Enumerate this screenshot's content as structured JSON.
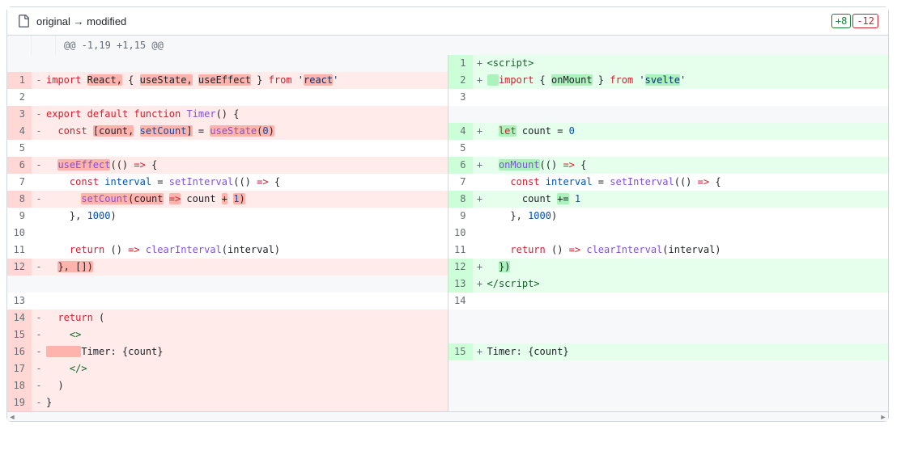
{
  "header": {
    "title": "original → modified",
    "badge_add": "+8",
    "badge_del": "-12"
  },
  "hunk": "@@ -1,19 +1,15 @@",
  "rows": [
    {
      "left": {
        "type": "empty"
      },
      "right": {
        "type": "add",
        "num": "1",
        "html": "<span class='tag'>&lt;script&gt;</span>"
      }
    },
    {
      "left": {
        "type": "del",
        "num": "1",
        "html": "<span class='kw'>import</span> <span class='wdel'>React,</span> { <span class='wdel'>useState,</span> <span class='wdel'>useEffect</span> } <span class='kw'>from</span> <span class='str'>'<span class='wdel'>react</span>'</span>"
      },
      "right": {
        "type": "add",
        "num": "2",
        "html": "<span class='wadd'>  </span><span class='kw'>import</span> { <span class='wadd'>onMount</span> } <span class='kw'>from</span> <span class='str'>'<span class='wadd'>svelte</span>'</span>"
      }
    },
    {
      "left": {
        "type": "ctx",
        "num": "2",
        "html": ""
      },
      "right": {
        "type": "ctx",
        "num": "3",
        "html": ""
      }
    },
    {
      "left": {
        "type": "del",
        "num": "3",
        "html": "<span class='kw'>export</span> <span class='kw'>default</span> <span class='kw'>function</span> <span class='fn'>Timer</span>() {"
      },
      "right": {
        "type": "empty"
      }
    },
    {
      "left": {
        "type": "del",
        "num": "4",
        "html": "  <span class='kw'>const</span> <span class='wdel'>[count,</span> <span class='wdel'><span class='def'>setCount</span>]</span> = <span class='wdel'><span class='fn'>useState</span>(<span class='num'>0</span>)</span>"
      },
      "right": {
        "type": "add",
        "num": "4",
        "html": "  <span class='wadd'><span class='kw'>let</span></span> count = <span class='num'>0</span>"
      }
    },
    {
      "left": {
        "type": "ctx",
        "num": "5",
        "html": ""
      },
      "right": {
        "type": "ctx",
        "num": "5",
        "html": ""
      }
    },
    {
      "left": {
        "type": "del",
        "num": "6",
        "html": "  <span class='wdel'><span class='fn'>useEffect</span></span>(() <span class='kw'>=&gt;</span> {"
      },
      "right": {
        "type": "add",
        "num": "6",
        "html": "  <span class='wadd'><span class='fn'>onMount</span></span>(() <span class='kw'>=&gt;</span> {"
      }
    },
    {
      "left": {
        "type": "ctx",
        "num": "7",
        "html": "    <span class='kw'>const</span> <span class='def'>interval</span> = <span class='fn'>setInterval</span>(() <span class='kw'>=&gt;</span> {"
      },
      "right": {
        "type": "ctx",
        "num": "7",
        "html": "    <span class='kw'>const</span> <span class='def'>interval</span> = <span class='fn'>setInterval</span>(() <span class='kw'>=&gt;</span> {"
      }
    },
    {
      "left": {
        "type": "del",
        "num": "8",
        "html": "      <span class='wdel'><span class='fn'>setCount</span>(count</span> <span class='wdel'><span class='kw'>=&gt;</span></span> count <span class='wdel'>+</span> <span class='wdel'><span class='num'>1</span>)</span>"
      },
      "right": {
        "type": "add",
        "num": "8",
        "html": "      count <span class='wadd'>+=</span> <span class='num'>1</span>"
      }
    },
    {
      "left": {
        "type": "ctx",
        "num": "9",
        "html": "    }, <span class='num'>1000</span>)"
      },
      "right": {
        "type": "ctx",
        "num": "9",
        "html": "    }, <span class='num'>1000</span>)"
      }
    },
    {
      "left": {
        "type": "ctx",
        "num": "10",
        "html": ""
      },
      "right": {
        "type": "ctx",
        "num": "10",
        "html": ""
      }
    },
    {
      "left": {
        "type": "ctx",
        "num": "11",
        "html": "    <span class='kw'>return</span> () <span class='kw'>=&gt;</span> <span class='fn'>clearInterval</span>(interval)"
      },
      "right": {
        "type": "ctx",
        "num": "11",
        "html": "    <span class='kw'>return</span> () <span class='kw'>=&gt;</span> <span class='fn'>clearInterval</span>(interval)"
      }
    },
    {
      "left": {
        "type": "del",
        "num": "12",
        "html": "  <span class='wdel'>}, [])</span>"
      },
      "right": {
        "type": "add",
        "num": "12",
        "html": "  <span class='wadd'>})</span>"
      }
    },
    {
      "left": {
        "type": "empty"
      },
      "right": {
        "type": "add",
        "num": "13",
        "html": "<span class='tag'>&lt;/script&gt;</span>"
      }
    },
    {
      "left": {
        "type": "ctx",
        "num": "13",
        "html": ""
      },
      "right": {
        "type": "ctx",
        "num": "14",
        "html": ""
      }
    },
    {
      "left": {
        "type": "del",
        "num": "14",
        "html": "  <span class='kw'>return</span> ("
      },
      "right": {
        "type": "empty"
      }
    },
    {
      "left": {
        "type": "del",
        "num": "15",
        "html": "    <span class='tag'>&lt;&gt;</span>"
      },
      "right": {
        "type": "empty"
      }
    },
    {
      "left": {
        "type": "del",
        "num": "16",
        "html": "<span class='wdel'>      </span>Timer: {count}"
      },
      "right": {
        "type": "add",
        "num": "15",
        "html": "Timer: {count}"
      }
    },
    {
      "left": {
        "type": "del",
        "num": "17",
        "html": "    <span class='tag'>&lt;/&gt;</span>"
      },
      "right": {
        "type": "empty"
      }
    },
    {
      "left": {
        "type": "del",
        "num": "18",
        "html": "  )"
      },
      "right": {
        "type": "empty"
      }
    },
    {
      "left": {
        "type": "del",
        "num": "19",
        "html": "}"
      },
      "right": {
        "type": "empty"
      }
    }
  ]
}
